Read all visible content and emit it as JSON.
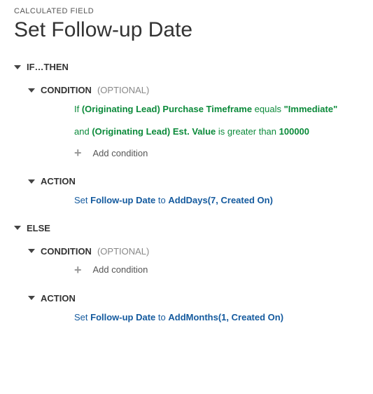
{
  "header": {
    "eyebrow": "CALCULATED FIELD",
    "title": "Set Follow-up Date"
  },
  "if_block": {
    "label": "IF…THEN",
    "condition": {
      "label": "CONDITION",
      "optional": "(OPTIONAL)",
      "line1": {
        "prefix": "If ",
        "field": "(Originating Lead) Purchase Timeframe",
        "op": " equals ",
        "value": "\"Immediate\""
      },
      "line2": {
        "prefix": "and ",
        "field": "(Originating Lead) Est. Value",
        "op": " is greater than ",
        "value": "100000"
      },
      "add_label": "Add condition"
    },
    "action": {
      "label": "ACTION",
      "set_text": "Set ",
      "field": "Follow-up Date",
      "to_text": " to ",
      "func": "AddDays(7, Created On)"
    }
  },
  "else_block": {
    "label": "ELSE",
    "condition": {
      "label": "CONDITION",
      "optional": "(OPTIONAL)",
      "add_label": "Add condition"
    },
    "action": {
      "label": "ACTION",
      "set_text": "Set ",
      "field": "Follow-up Date",
      "to_text": " to ",
      "func": "AddMonths(1, Created On)"
    }
  }
}
